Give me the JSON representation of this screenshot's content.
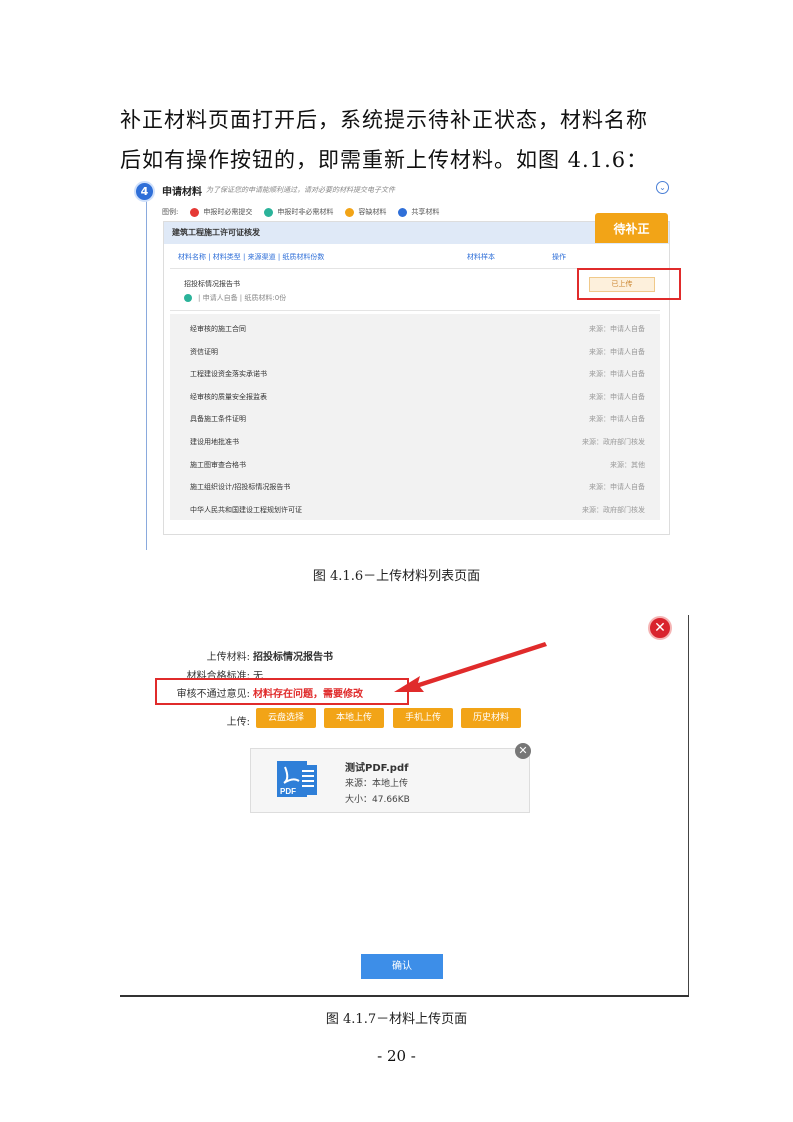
{
  "intro": {
    "line1": "补正材料页面打开后，系统提示待补正状态，材料名称",
    "line2": "后如有操作按钮的，即需重新上传材料。如图 4.1.6："
  },
  "figure1": {
    "step_number": "4",
    "step_title": "申请材料",
    "step_hint": "为了保证您的申请能顺利通过，请对必要的材料提交电子文件",
    "collapse_icon": "⌄",
    "legend": {
      "label": "图例:",
      "items": [
        {
          "label": "申报时必需提交",
          "color": "#e53935",
          "symbol": "必"
        },
        {
          "label": "申报时非必需材料",
          "color": "#2bb39a",
          "symbol": "非"
        },
        {
          "label": "容缺材料",
          "color": "#f2a417",
          "symbol": "容"
        },
        {
          "label": "共享材料",
          "color": "#2f6fd8",
          "symbol": "共"
        }
      ]
    },
    "panel_title": "建筑工程施工许可证核发",
    "status_badge": "待补正",
    "columns": {
      "col1": "材料名称 | 材料类型 | 来源渠道 | 纸质材料份数",
      "col2": "材料样本",
      "col3": "操作"
    },
    "item1": {
      "name": "招投标情况报告书",
      "meta": "| 申请人自备 | 纸质材料:0份",
      "action": "已上传"
    },
    "rows": [
      {
        "name": "经审核的施工合同",
        "source": "来源：申请人自备"
      },
      {
        "name": "资信证明",
        "source": "来源：申请人自备"
      },
      {
        "name": "工程建设资金落实承诺书",
        "source": "来源：申请人自备"
      },
      {
        "name": "经审核的质量安全报监表",
        "source": "来源：申请人自备"
      },
      {
        "name": "具备施工条件证明",
        "source": "来源：申请人自备"
      },
      {
        "name": "建设用地批准书",
        "source": "来源：政府部门核发"
      },
      {
        "name": "施工图审查合格书",
        "source": "来源：其他"
      },
      {
        "name": "施工组织设计/招投标情况报告书",
        "source": "来源：申请人自备"
      },
      {
        "name": "中华人民共和国建设工程规划许可证",
        "source": "来源：政府部门核发"
      }
    ],
    "caption": "图 4.1.6－上传材料列表页面"
  },
  "figure2": {
    "close_icon": "✕",
    "upload_material_label": "上传材料:",
    "upload_material_value": "招投标情况报告书",
    "standard_label": "材料合格标准:",
    "standard_value": "无",
    "reject_label": "审核不通过意见:",
    "reject_value": "材料存在问题，需要修改",
    "upload_label": "上传:",
    "buttons": [
      "云盘选择",
      "本地上传",
      "手机上传",
      "历史材料"
    ],
    "file": {
      "name": "测试PDF.pdf",
      "source": "来源：本地上传",
      "size": "大小：47.66KB",
      "icon_text": "PDF",
      "remove_icon": "✕"
    },
    "confirm": "确认",
    "caption": "图 4.1.7－材料上传页面"
  },
  "page_number": "- 20 -"
}
